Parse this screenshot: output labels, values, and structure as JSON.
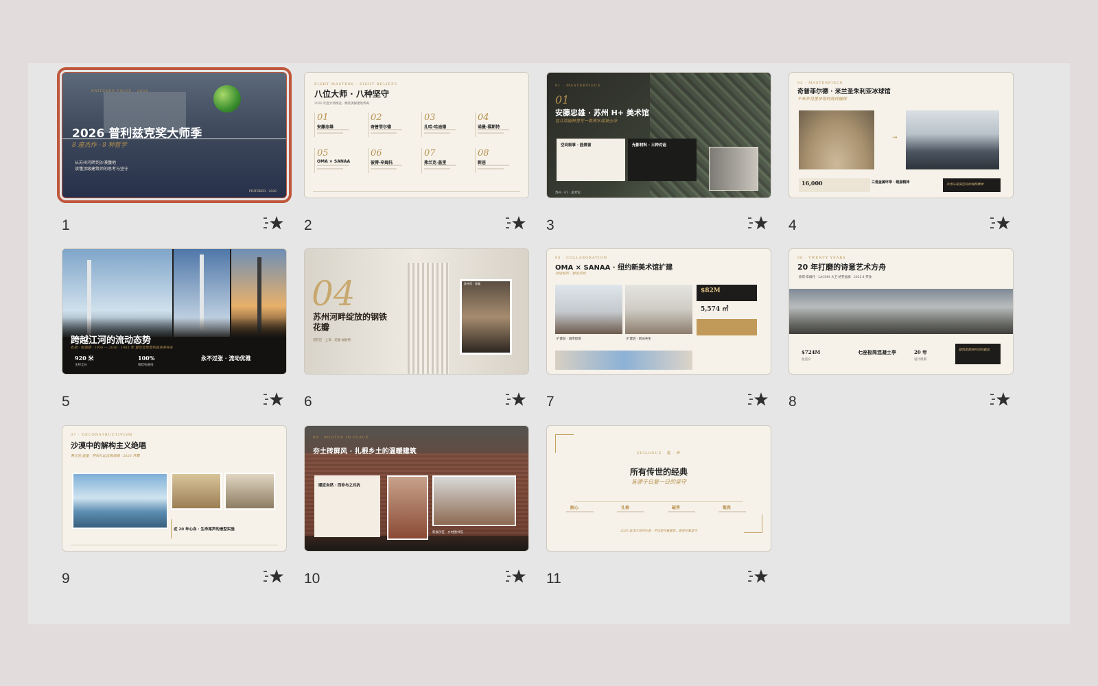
{
  "colors": {
    "selection": "#c0573c",
    "gold": "#b8914e",
    "paper": "#f6f2ea",
    "dark": "#1f1e1d"
  },
  "slides": [
    {
      "number": "1",
      "title": "2026 普利兹克奖大师季",
      "subtitle": "8 座杰作 · 8 种哲学",
      "kicker": "PRITZKER PRIZE · 2026",
      "lines": [
        "从苏州河畔到沙漠腹地",
        "读懂顶级建筑师的思考与坚守"
      ],
      "footer_right": "PRITZKER · 2026"
    },
    {
      "number": "2",
      "title": "八位大师 · 八种坚守",
      "kicker": "EIGHT MASTERS · EIGHT BELIEFS",
      "subtitle": "2026 年度大师精选 · 精装演绎建筑传奇",
      "masters": [
        {
          "n": "01",
          "name": "安藤忠雄"
        },
        {
          "n": "02",
          "name": "奇普菲尔德"
        },
        {
          "n": "03",
          "name": "扎哈·哈迪德"
        },
        {
          "n": "04",
          "name": "诺曼·福斯特"
        },
        {
          "n": "05",
          "name": "OMA × SANAA"
        },
        {
          "n": "06",
          "name": "彼得·卒姆托"
        },
        {
          "n": "07",
          "name": "弗兰克·盖里"
        },
        {
          "n": "08",
          "name": "新居"
        }
      ]
    },
    {
      "number": "3",
      "n": "01",
      "title": "安藤忠雄 · 苏州 H+ 美术馆",
      "subtitle": "在江南园林里写一首清水混凝土诗",
      "kicker": "01 · MASTERPIECE",
      "box_left": "空间叙事 · 园景窗",
      "box_right": "光影材料 · 三种对话",
      "footer": "苏州 · 01 · 美术馆"
    },
    {
      "number": "4",
      "title": "奇普菲尔德 · 米兰圣朱利亚冰球馆",
      "subtitle": "千年岁月里孕育的现代碗体",
      "kicker": "02 · MASTERPIECE",
      "stat": "16,000",
      "stat2": "三道金属环带 · 碗屋精神",
      "note": "冰场与观演空间的纯粹精神"
    },
    {
      "number": "5",
      "title": "跨越江河的流动态势",
      "subtitle": "札哈 · 哈迪德 · 1950 — 2016 · 1985 年 首位女性普利兹克奖得主",
      "stats": [
        {
          "v": "920 米",
          "l": "主桥全长"
        },
        {
          "v": "100%",
          "l": "钢结构曲线"
        },
        {
          "v": "永不过张 · 流动优雅",
          "l": ""
        }
      ]
    },
    {
      "number": "6",
      "n": "04",
      "title": "苏州河畔绽放的钢铁花瓣",
      "subtitle": "普陀区 · 上海 · 诺曼·福斯特",
      "chip": "苏州河 · 花瓣"
    },
    {
      "number": "7",
      "title": "OMA × SANAA · 纽约新美术馆扩建",
      "subtitle": "对话城市 · 新旧交织",
      "kicker": "05 · COLLABORATION",
      "stat": "$82M",
      "stat2": "5,574 ㎡",
      "caption_left": "扩建前 · 城市街景",
      "caption_right": "扩建后 · 新旧共生"
    },
    {
      "number": "8",
      "title": "20 年打磨的诗意艺术方舟",
      "kicker": "06 · TWENTY YEARS",
      "subtitle": "彼得·卒姆托 · LACMA 大卫·格芬画廊 · 2025.4 开放",
      "stats": [
        {
          "v": "$724M",
          "l": "总造价"
        },
        {
          "v": "七座极简混凝土亭",
          "l": ""
        },
        {
          "v": "20 年",
          "l": "设计周期"
        }
      ],
      "chip": "建筑是容纳时间的器皿"
    },
    {
      "number": "9",
      "title": "沙漠中的解构主义绝唱",
      "subtitle": "弗兰克·盖里 · 阿布扎比古根海姆 · 2026 开幕",
      "kicker": "07 · DECONSTRUCTIVISM",
      "caption": "近 20 年心血 · 生命尾声的造型实验"
    },
    {
      "number": "10",
      "title": "夯土砖屏风 · 扎根乡土的温暖建筑",
      "kicker": "08 · ROOTED IN PLACE",
      "box": "顺应自然 · 而非与之对抗",
      "caption": "新展示区 · 乡村图书馆"
    },
    {
      "number": "11",
      "title": "所有传世的经典",
      "subtitle": "皆源于日复一日的坚守",
      "kicker": "EPILOGUE · 尾 · 声",
      "pillars": [
        "耐心",
        "扎根",
        "破界",
        "敬畏"
      ],
      "quote": "2026 这场大师的作季 · 不仅是在看建筑，更是在看坚守"
    }
  ]
}
